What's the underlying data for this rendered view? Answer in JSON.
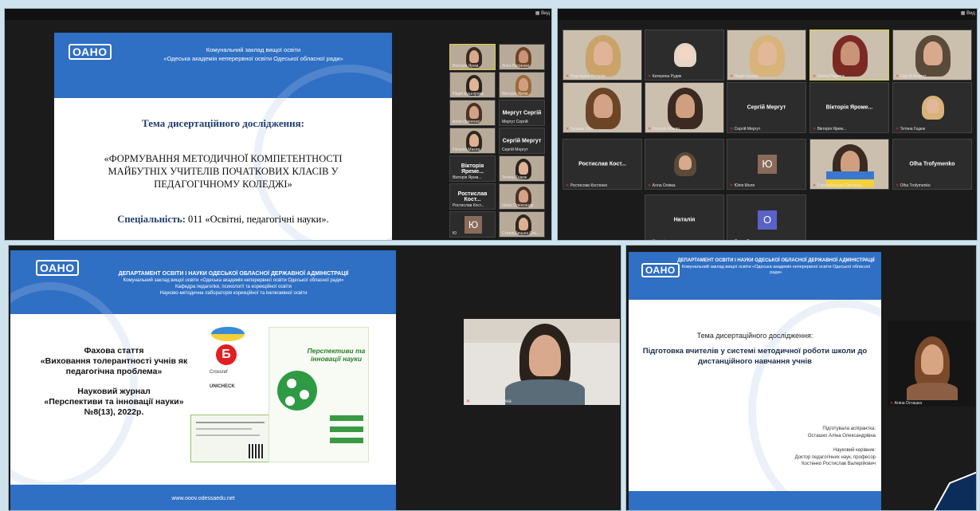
{
  "q1": {
    "view_label": "Вид",
    "logo": "ОАНО",
    "header_line1": "Комунальний заклад вищої освіти",
    "header_line2": "«Одеська академія неперервної освіти Одеської обласної ради»",
    "topic_label": "Тема дисертаційного дослідження:",
    "topic_text": "«ФОРМУВАННЯ МЕТОДИЧНОЇ КОМПЕТЕНТНОСТІ МАЙБУТНІХ УЧИТЕЛІВ ПОЧАТКОВИХ КЛАСІВ У ПЕДАГОГІЧНОМУ КОЛЕДЖІ»",
    "spec_label": "Спеціальність:",
    "spec_value": " 011 «Освітні, педагогічні науки».",
    "participants": [
      {
        "name": "Вікторія Ярем..."
      },
      {
        "name": "Лілія Петренко"
      },
      {
        "name": "Надія Кушнірова"
      },
      {
        "name": "Вікторія Ярем..."
      },
      {
        "name": "Алла Гриненко"
      },
      {
        "name": "Мергут Сергій",
        "label": "Мергут Сергій"
      },
      {
        "name": "Наталія Маєва"
      },
      {
        "name": "Сергій Мергут",
        "label": "Сергій Мергут"
      },
      {
        "name": "Вікторія Ярем...",
        "label": "Вікторія Яреме..."
      },
      {
        "name": "Тетяна Гедеж"
      },
      {
        "name": "Ростислав Кост...",
        "label": "Ростислав Кост..."
      },
      {
        "name": "Шева Олександр"
      },
      {
        "name": "Ю",
        "label": "Ю"
      },
      {
        "name": "Стрельбицька Оль..."
      }
    ]
  },
  "q2": {
    "view_label": "Вид",
    "tiles": [
      {
        "name": "Рудницька Наталія"
      },
      {
        "name": "Катерина Рудяк"
      },
      {
        "name": "Надія Кушнір"
      },
      {
        "name": "Олена Павлюк"
      },
      {
        "name": "Сергій Мергут"
      },
      {
        "name": "Бурщак Оль"
      },
      {
        "name": "Наталія Маєва"
      },
      {
        "name": "Сергій Мергут",
        "label": "Сергій Мергут"
      },
      {
        "name": "Вікторія Ярем...",
        "label": "Вікторія Яроме..."
      },
      {
        "name": "Тетяна Гедеж"
      },
      {
        "name": "Ростислав Костенко",
        "label": "Ростислав Кост..."
      },
      {
        "name": "Алла Оліяка"
      },
      {
        "name": "Юлія Моля",
        "label": "Ю"
      },
      {
        "name": "Стрельбицька Світлана"
      },
      {
        "name": "Olha Trofymenko",
        "label": "Olha Trofymenko"
      },
      {
        "name": "Наталія",
        "label": "Наталія"
      },
      {
        "name": "Ольга Савенко",
        "label": "О"
      }
    ]
  },
  "q3": {
    "logo": "ОАНО",
    "header_line1": "ДЕПАРТАМЕНТ ОСВІТИ  І НАУКИ ОДЕСЬКОЇ ОБЛАСНОЇ ДЕРЖАВНОЇ АДМІНІСТРАЦІЇ",
    "header_line2": "Комунальний заклад вищої освіти «Одеська академія неперервної освіти Одеської обласної ради»",
    "header_line3": "Кафедра педагогіки, психології та корекційної освіти",
    "header_line4": "Науково-методична лабораторія корекційної та інклюзивної освіти",
    "article_title": "Фахова стаття",
    "article_name": "«Виховання толерантності учнів як педагогічна проблема»",
    "journal_title": "Науковий журнал",
    "journal_name": "«Перспективи та інновації науки» №8(13), 2022р.",
    "cover_title": "Перспективи та інновації науки",
    "footer_url": "www.ooov.odessaedu.net",
    "badges": [
      "Б",
      "Crossref",
      "UNICHECK"
    ],
    "video_name": "Солодкова Олена"
  },
  "q4": {
    "logo": "ОАНО",
    "header_line1": "ДЕПАРТАМЕНТ ОСВІТИ  І НАУКИ ОДЕСЬКОЇ ОБЛАСНОЇ ДЕРЖАВНОЇ АДМІНІСТРАЦІЇ",
    "header_line2": "Комунальний заклад вищої освіти «Одеська академія неперервної освіти Одеської обласної ради»",
    "topic_label": "Тема дисертаційного дослідження:",
    "topic_text": "Підготовка вчителів у системі методичної роботи школи до дистанційного навчання учнів",
    "prepared_label": "Підготувала аспірантка:",
    "prepared_name": "Осташко Аліна Олександрівна",
    "advisor_label": "Науковий керівник:",
    "advisor_line1": "Доктор педагогічних наук, професор",
    "advisor_line2": "Костенко Ростислав Валерійович",
    "video_name": "Аліна Осташко"
  }
}
